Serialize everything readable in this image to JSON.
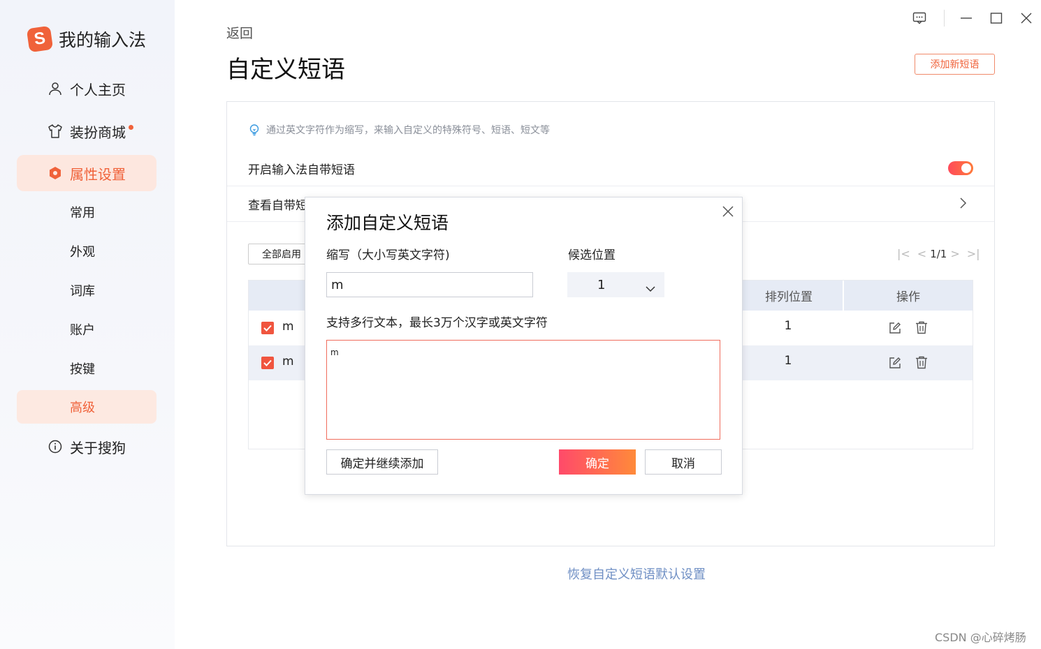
{
  "app": {
    "name": "我的输入法",
    "logo_letter": "S",
    "accent": "#f0623a"
  },
  "sidebar": {
    "items": [
      {
        "label": "个人主页",
        "icon": "user-icon"
      },
      {
        "label": "装扮商城",
        "icon": "shirt-icon",
        "badge": "red-dot"
      },
      {
        "label": "属性设置",
        "icon": "hexagon-settings-icon"
      },
      {
        "label": "关于搜狗",
        "icon": "info-icon"
      }
    ],
    "sub_items": [
      {
        "label": "常用"
      },
      {
        "label": "外观"
      },
      {
        "label": "词库"
      },
      {
        "label": "账户"
      },
      {
        "label": "按键"
      },
      {
        "label": "高级"
      }
    ]
  },
  "header": {
    "back": "返回",
    "title": "自定义短语",
    "add_button": "添加新短语"
  },
  "panel": {
    "hint": "通过英文字符作为缩写，来输入自定义的特殊符号、短语、短文等",
    "toggle_label": "开启输入法自带短语",
    "toggle_on": true,
    "view_label": "查看自带短",
    "enable_all": "全部启用",
    "pager": "1/1",
    "table": {
      "columns": [
        "排列位置",
        "操作"
      ],
      "rows": [
        {
          "checked": true,
          "abbr": "m",
          "position": "1"
        },
        {
          "checked": true,
          "abbr": "m",
          "position": "1"
        }
      ]
    }
  },
  "restore_link": "恢复自定义短语默认设置",
  "watermark": "CSDN @心碎烤肠",
  "modal": {
    "title": "添加自定义短语",
    "abbr_label": "缩写（大小写英文字符)",
    "abbr_value": "m",
    "position_label": "候选位置",
    "position_value": "1",
    "text_label": "支持多行文本，最长3万个汉字或英文字符",
    "text_value": "m",
    "confirm_continue": "确定并继续添加",
    "confirm": "确定",
    "cancel": "取消"
  }
}
